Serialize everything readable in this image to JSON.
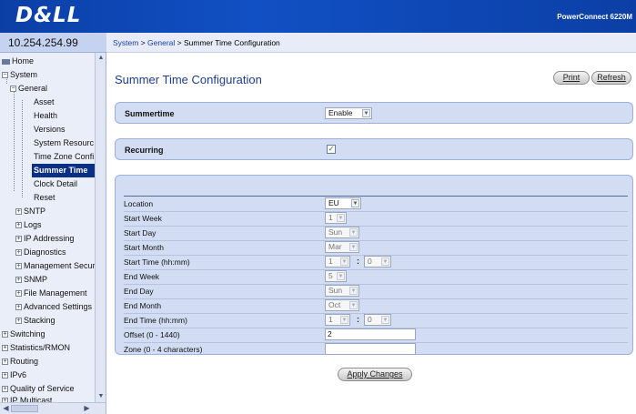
{
  "header": {
    "logo": "D&LL",
    "product": "PowerConnect 6220M"
  },
  "ip": "10.254.254.99",
  "breadcrumb": {
    "system": "System",
    "sep1": " > ",
    "general": "General",
    "sep2": " > ",
    "current": "Summer Time Configuration"
  },
  "sidebar": {
    "items": [
      {
        "label": "Home"
      },
      {
        "label": "System"
      },
      {
        "label": "General"
      },
      {
        "label": "Asset"
      },
      {
        "label": "Health"
      },
      {
        "label": "Versions"
      },
      {
        "label": "System Resourc"
      },
      {
        "label": "Time Zone Confi"
      },
      {
        "label": "Summer Time"
      },
      {
        "label": "Clock Detail"
      },
      {
        "label": "Reset"
      },
      {
        "label": "SNTP"
      },
      {
        "label": "Logs"
      },
      {
        "label": "IP Addressing"
      },
      {
        "label": "Diagnostics"
      },
      {
        "label": "Management Secur"
      },
      {
        "label": "SNMP"
      },
      {
        "label": "File Management"
      },
      {
        "label": "Advanced Settings"
      },
      {
        "label": "Stacking"
      },
      {
        "label": "Switching"
      },
      {
        "label": "Statistics/RMON"
      },
      {
        "label": "Routing"
      },
      {
        "label": "IPv6"
      },
      {
        "label": "Quality of Service"
      },
      {
        "label": "IP Multicast"
      }
    ]
  },
  "page": {
    "title": "Summer Time Configuration",
    "print_label": "Print",
    "refresh_label": "Refresh",
    "apply_label": "Apply Changes"
  },
  "summertime": {
    "label": "Summertime",
    "value": "Enable"
  },
  "recurring": {
    "label": "Recurring",
    "checked": "✓"
  },
  "fields": {
    "location": {
      "label": "Location",
      "value": "EU"
    },
    "start_week": {
      "label": "Start Week",
      "value": "1"
    },
    "start_day": {
      "label": "Start Day",
      "value": "Sun"
    },
    "start_month": {
      "label": "Start Month",
      "value": "Mar"
    },
    "start_time": {
      "label": "Start Time (hh:mm)",
      "hh": "1",
      "mm": "0"
    },
    "end_week": {
      "label": "End Week",
      "value": "5"
    },
    "end_day": {
      "label": "End Day",
      "value": "Sun"
    },
    "end_month": {
      "label": "End Month",
      "value": "Oct"
    },
    "end_time": {
      "label": "End Time (hh:mm)",
      "hh": "1",
      "mm": "0"
    },
    "offset": {
      "label": "Offset (0 - 1440)",
      "value": "2"
    },
    "zone": {
      "label": "Zone (0 - 4 characters)",
      "value": ""
    }
  },
  "icons": {
    "expand": "+",
    "collapse": "−",
    "dropdown": "chevron-down-icon"
  },
  "colors": {
    "header": "#0b3fa6",
    "panel": "#d2dcf3",
    "selected": "#0c2f86",
    "title": "#1d3d8f"
  }
}
